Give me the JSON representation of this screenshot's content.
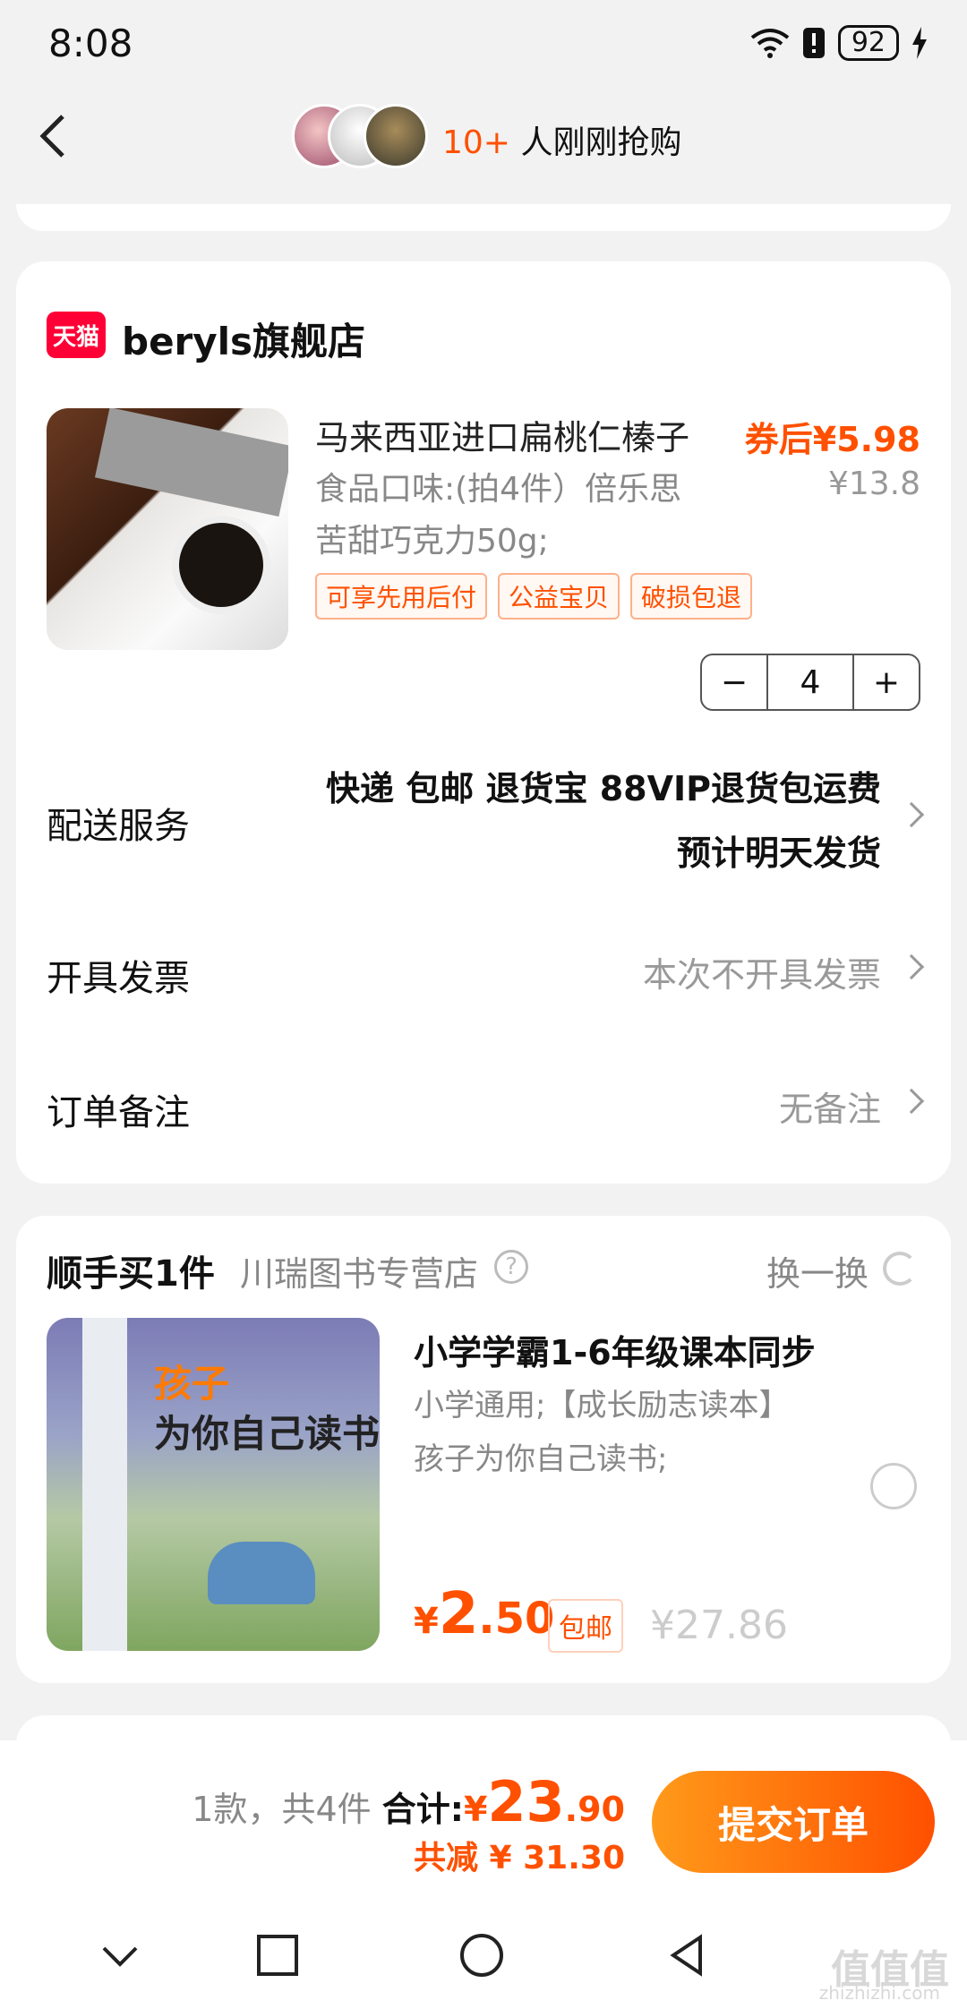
{
  "status": {
    "time": "8:08",
    "battery": "92"
  },
  "header": {
    "count": "10+",
    "text": "人刚刚抢购"
  },
  "store": {
    "badge": "天猫",
    "name": "beryls旗舰店"
  },
  "product": {
    "title": "马来西亚进口扁桃仁榛子",
    "spec_line1": "食品口味:(拍4件）倍乐思",
    "spec_line2": "苦甜巧克力50g;",
    "coupon_price": "券后¥5.98",
    "orig_price": "¥13.8",
    "tags": [
      "可享先用后付",
      "公益宝贝",
      "破损包退"
    ],
    "qty": "4",
    "minus": "−",
    "plus": "+"
  },
  "rows": {
    "shipping_label": "配送服务",
    "shipping_line1": "快递 包邮 退货宝 88VIP退货包运费",
    "shipping_line2": "预计明天发货",
    "invoice_label": "开具发票",
    "invoice_value": "本次不开具发票",
    "note_label": "订单备注",
    "note_value": "无备注"
  },
  "addon": {
    "title": "顺手买1件",
    "store": "川瑞图书专营店",
    "help": "?",
    "swap": "换一换",
    "book_title1": "孩子",
    "book_title2": "为你自己读书",
    "name": "小学学霸1-6年级课本同步",
    "spec_line1": "小学通用;【成长励志读本】",
    "spec_line2": "孩子为你自己读书;",
    "price_cur": "¥",
    "price_int": "2",
    "price_dec": ".50",
    "free_shipping": "包邮",
    "orig_price": "¥27.86"
  },
  "footer": {
    "count_text": "1款，共4件",
    "total_label": "合计:",
    "total_cur": "¥",
    "total_int": "23",
    "total_dec": ".90",
    "saved": "共减 ¥ 31.30",
    "submit": "提交订单"
  },
  "watermark": {
    "main": "值值值",
    "sub": "zhizhizhi.com"
  },
  "colors": {
    "accent": "#ff5000",
    "tmall": "#ff0036"
  }
}
